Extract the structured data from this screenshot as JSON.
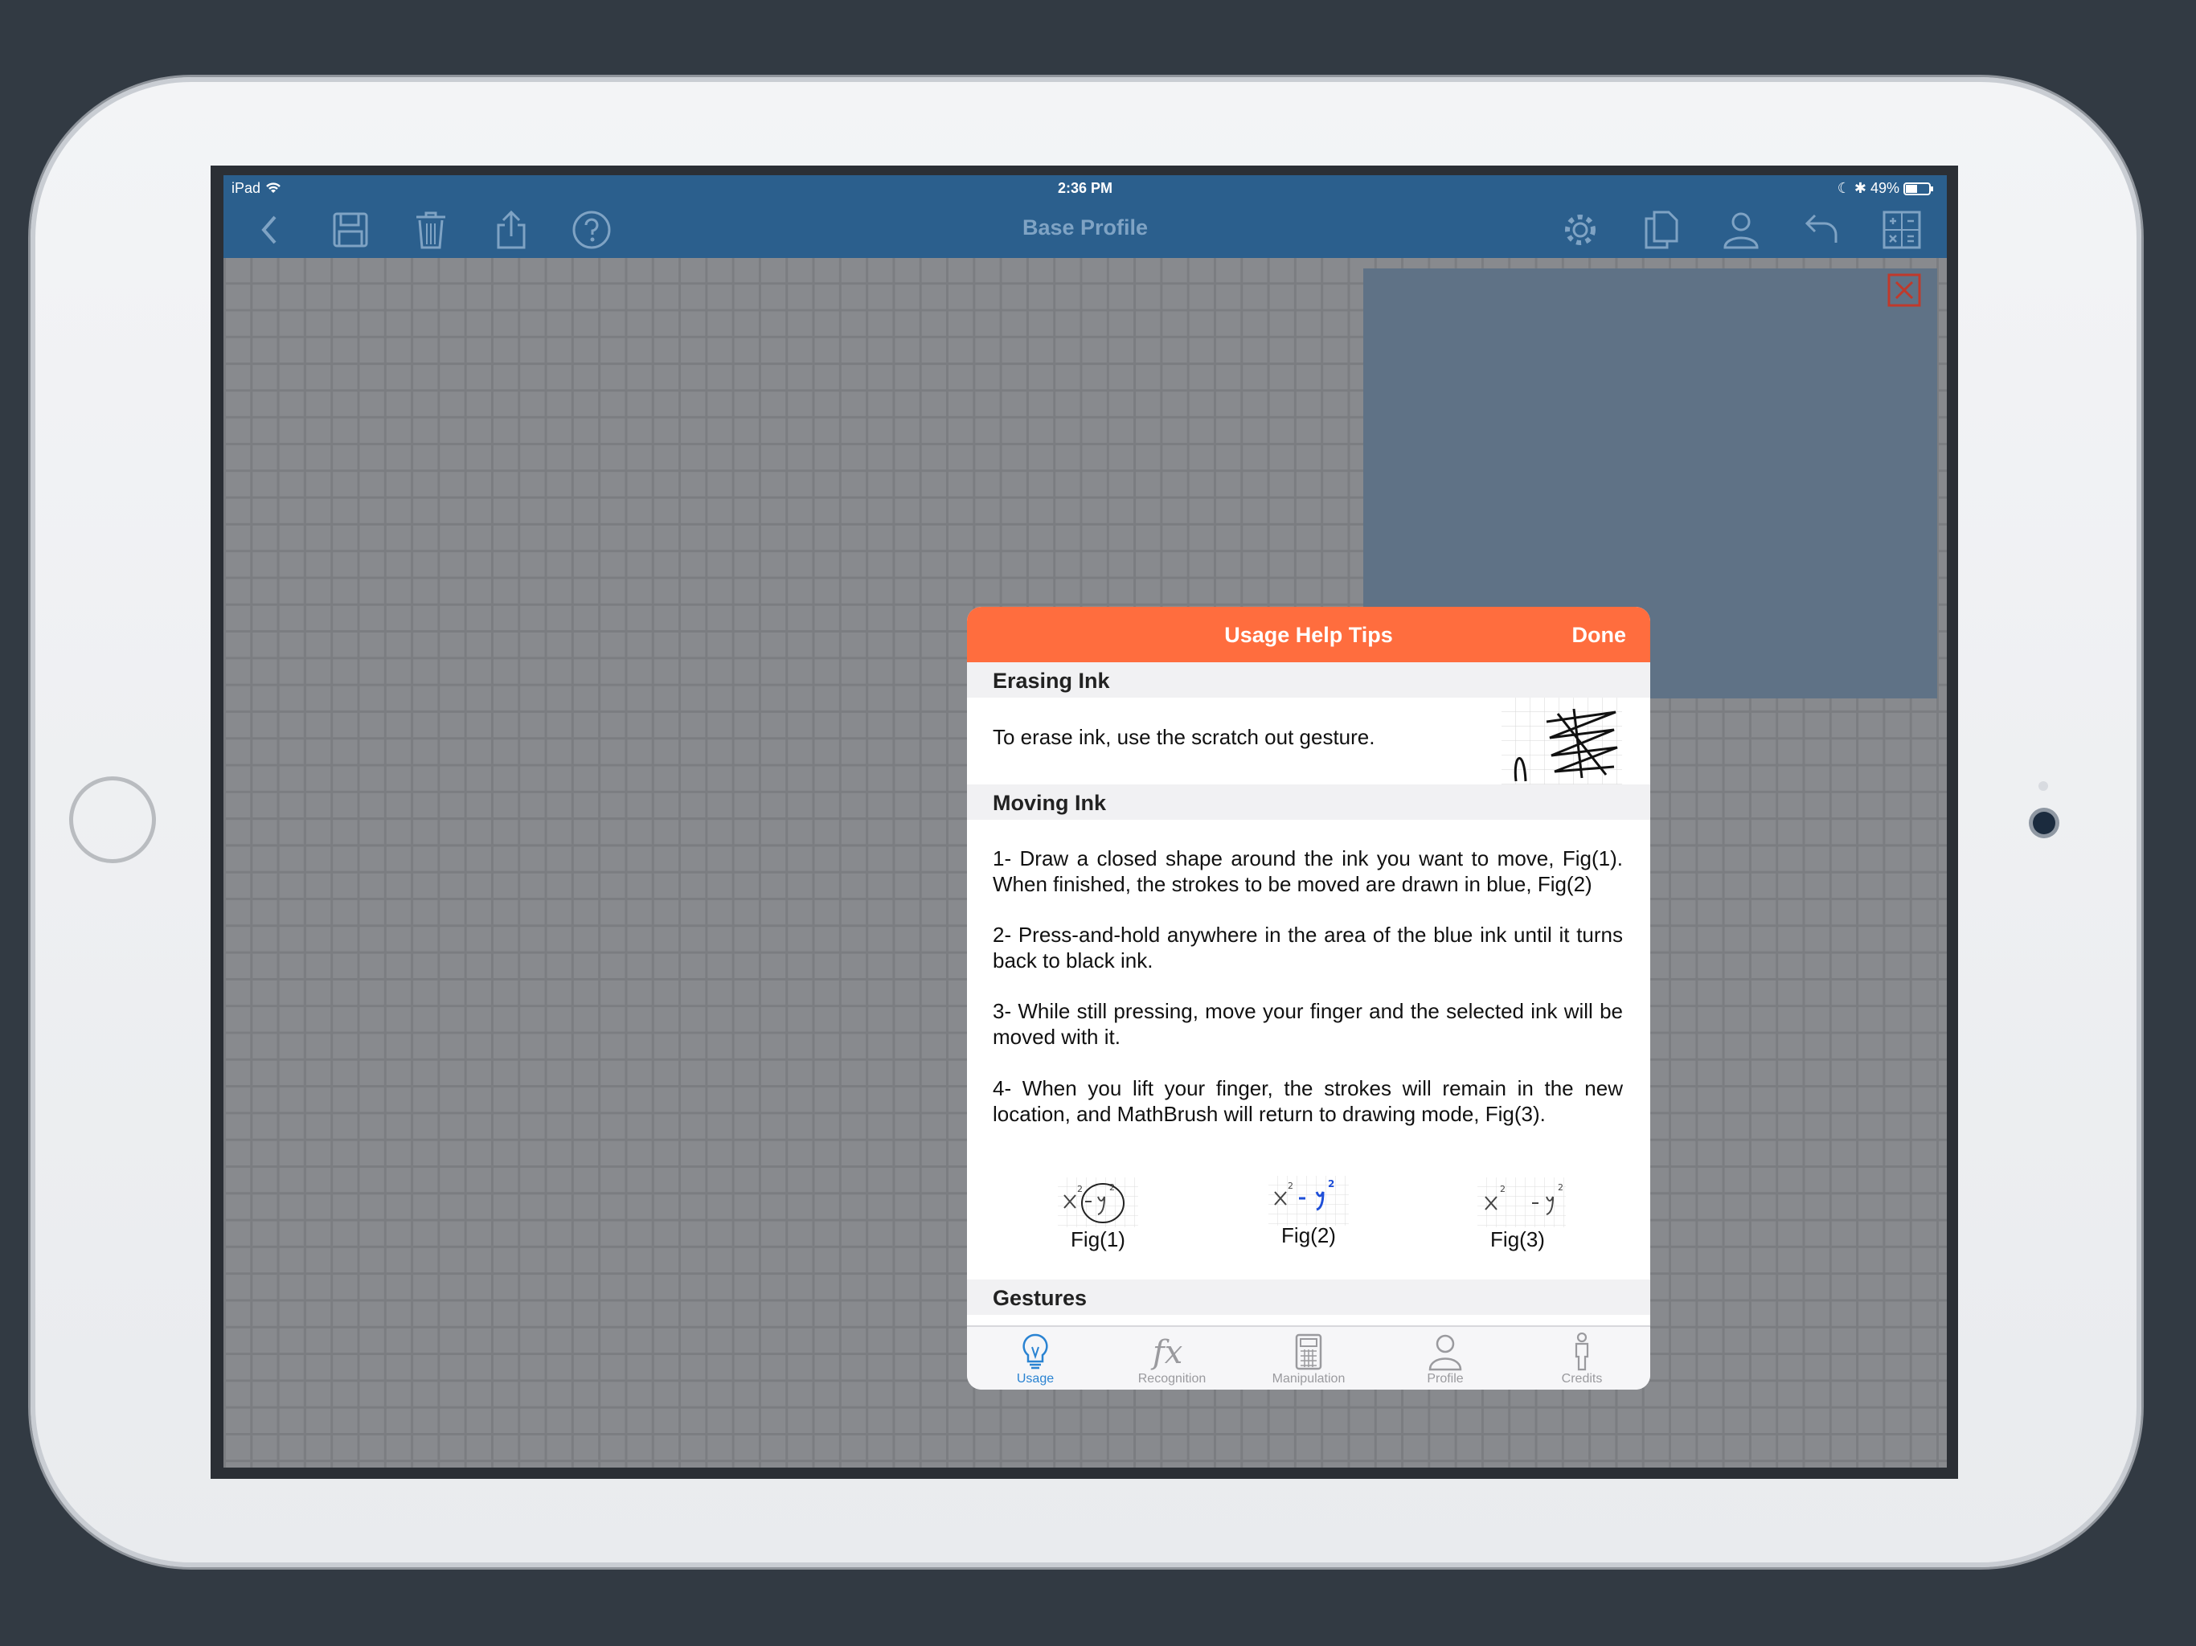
{
  "status_bar": {
    "device": "iPad",
    "time": "2:36 PM",
    "battery": "49%"
  },
  "navbar": {
    "title": "Base Profile",
    "left_icons": [
      "back-icon",
      "save-icon",
      "trash-icon",
      "share-icon",
      "help-icon"
    ],
    "right_icons": [
      "gear-icon",
      "copy-icon",
      "profile-icon",
      "undo-icon",
      "calculator-icon"
    ]
  },
  "modal": {
    "title": "Usage Help Tips",
    "done_label": "Done",
    "sections": {
      "erasing": {
        "heading": "Erasing Ink",
        "text": "To erase ink, use the scratch out gesture."
      },
      "moving": {
        "heading": "Moving Ink",
        "steps": [
          "1- Draw a closed shape around the ink you want to move, Fig(1). When finished, the strokes to be moved are drawn in blue, Fig(2)",
          "2- Press-and-hold anywhere in the area of the blue ink until it turns back to black ink.",
          "3- While still pressing, move your finger and the selected ink will be moved with it.",
          "4- When you lift your finger, the strokes will remain in the new location, and MathBrush will return to drawing mode, Fig(3)."
        ],
        "figures": [
          "Fig(1)",
          "Fig(2)",
          "Fig(3)"
        ]
      },
      "gestures": {
        "heading": "Gestures"
      }
    },
    "tabs": [
      {
        "label": "Usage",
        "icon": "lightbulb-icon",
        "active": true
      },
      {
        "label": "Recognition",
        "icon": "fx-icon",
        "active": false
      },
      {
        "label": "Manipulation",
        "icon": "calculator-icon",
        "active": false
      },
      {
        "label": "Profile",
        "icon": "person-icon",
        "active": false
      },
      {
        "label": "Credits",
        "icon": "standing-person-icon",
        "active": false
      }
    ]
  },
  "colors": {
    "navbar": "#2b5f8d",
    "modal_header": "#ff6d3e",
    "tab_active": "#2a83d2",
    "panel": "#5f7286",
    "close_red": "#c0392b"
  }
}
